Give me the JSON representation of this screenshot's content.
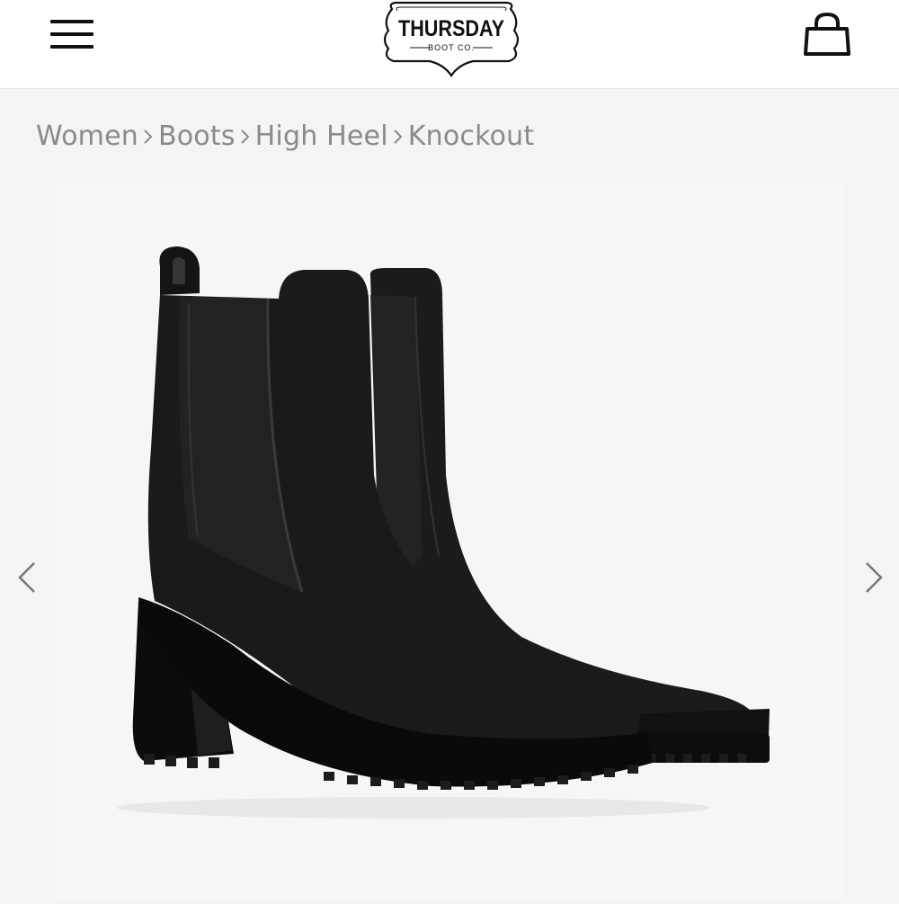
{
  "header": {
    "menu_icon": "hamburger-menu-icon",
    "logo_text": "THURSDAY",
    "logo_subtext": "BOOT CO.",
    "cart_icon": "shopping-bag-icon"
  },
  "breadcrumb": [
    {
      "label": "Women"
    },
    {
      "label": "Boots"
    },
    {
      "label": "High Heel"
    },
    {
      "label": "Knockout"
    }
  ],
  "gallery": {
    "image_description_icon": "product-image",
    "prev_icon": "chevron-left-icon",
    "next_icon": "chevron-right-icon"
  },
  "colors": {
    "header_bg": "#ffffff",
    "page_bg": "#f4f4f4",
    "breadcrumb_text": "#8a8a8a",
    "icon": "#111111"
  }
}
